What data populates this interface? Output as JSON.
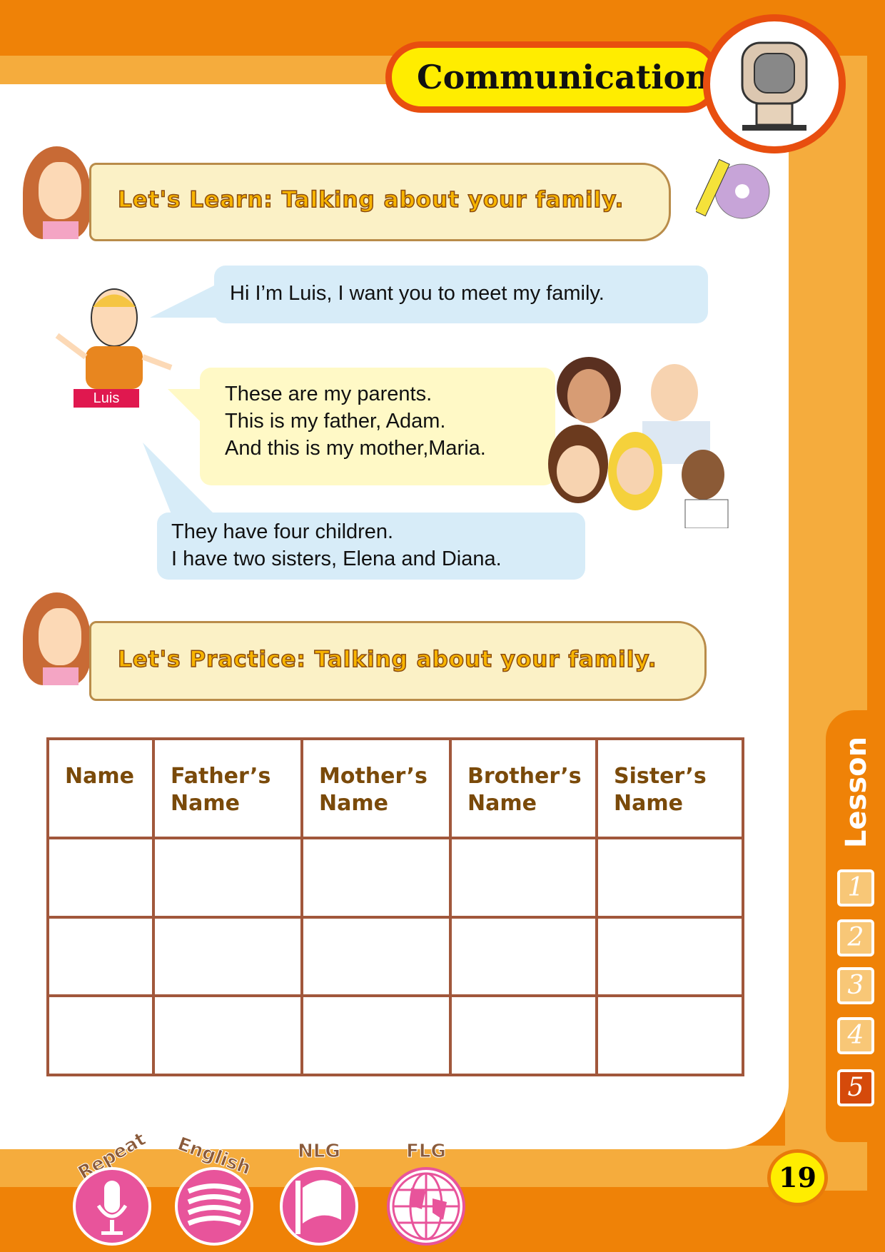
{
  "header": {
    "title": "Communication"
  },
  "learn": {
    "banner": "Let's Learn: Talking about your family.",
    "character_name": "Luis",
    "bubble1": "Hi I’m Luis, I want you to meet my family.",
    "bubble2": [
      "These are my parents.",
      "This is my father, Adam.",
      "And this is my mother,Maria."
    ],
    "bubble3": [
      "They have four children.",
      "I have two sisters, Elena and Diana."
    ]
  },
  "practice": {
    "banner": "Let's Practice: Talking about your family.",
    "table": {
      "headers": [
        [
          "Name",
          ""
        ],
        [
          "Father’s",
          "Name"
        ],
        [
          "Mother’s",
          "Name"
        ],
        [
          "Brother’s",
          "Name"
        ],
        [
          "Sister’s",
          "Name"
        ]
      ],
      "rows": 3
    }
  },
  "lesson_tab": {
    "label": "Lesson",
    "items": [
      "1",
      "2",
      "3",
      "4",
      "5"
    ],
    "active": "5"
  },
  "footer": {
    "badges": [
      "Repeat",
      "English",
      "NLG",
      "FLG"
    ],
    "page_number": "19"
  },
  "colors": {
    "orange": "#EF8207",
    "light_orange": "#F5AC3D",
    "pink": "#E8549B",
    "table_border": "#A1573B"
  }
}
